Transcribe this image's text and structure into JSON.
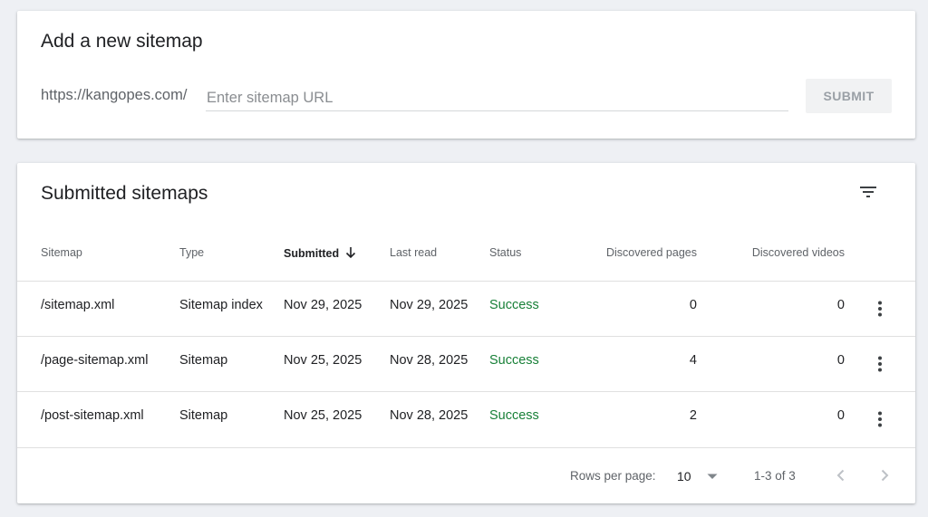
{
  "add_sitemap": {
    "title": "Add a new sitemap",
    "url_prefix": "https://kangopes.com/",
    "input_value": "",
    "input_placeholder": "Enter sitemap URL",
    "submit_label": "SUBMIT"
  },
  "submitted": {
    "title": "Submitted sitemaps",
    "filter_icon": "filter-icon",
    "columns": {
      "sitemap": "Sitemap",
      "type": "Type",
      "submitted": "Submitted",
      "last_read": "Last read",
      "status": "Status",
      "discovered_pages": "Discovered pages",
      "discovered_videos": "Discovered videos"
    },
    "sort": {
      "column": "submitted",
      "direction": "descending"
    },
    "rows": [
      {
        "sitemap": "/sitemap.xml",
        "type": "Sitemap index",
        "submitted": "Nov 29, 2025",
        "last_read": "Nov 29, 2025",
        "status": "Success",
        "discovered_pages": "0",
        "discovered_videos": "0"
      },
      {
        "sitemap": "/page-sitemap.xml",
        "type": "Sitemap",
        "submitted": "Nov 25, 2025",
        "last_read": "Nov 28, 2025",
        "status": "Success",
        "discovered_pages": "4",
        "discovered_videos": "0"
      },
      {
        "sitemap": "/post-sitemap.xml",
        "type": "Sitemap",
        "submitted": "Nov 25, 2025",
        "last_read": "Nov 28, 2025",
        "status": "Success",
        "discovered_pages": "2",
        "discovered_videos": "0"
      }
    ],
    "footer": {
      "rows_per_page_label": "Rows per page:",
      "rows_per_page_value": "10",
      "range_text": "1-3 of 3"
    }
  },
  "colors": {
    "background": "#eef0f4",
    "card": "#ffffff",
    "success": "#188038",
    "muted_text": "#5f6368",
    "primary_text": "#202124"
  }
}
